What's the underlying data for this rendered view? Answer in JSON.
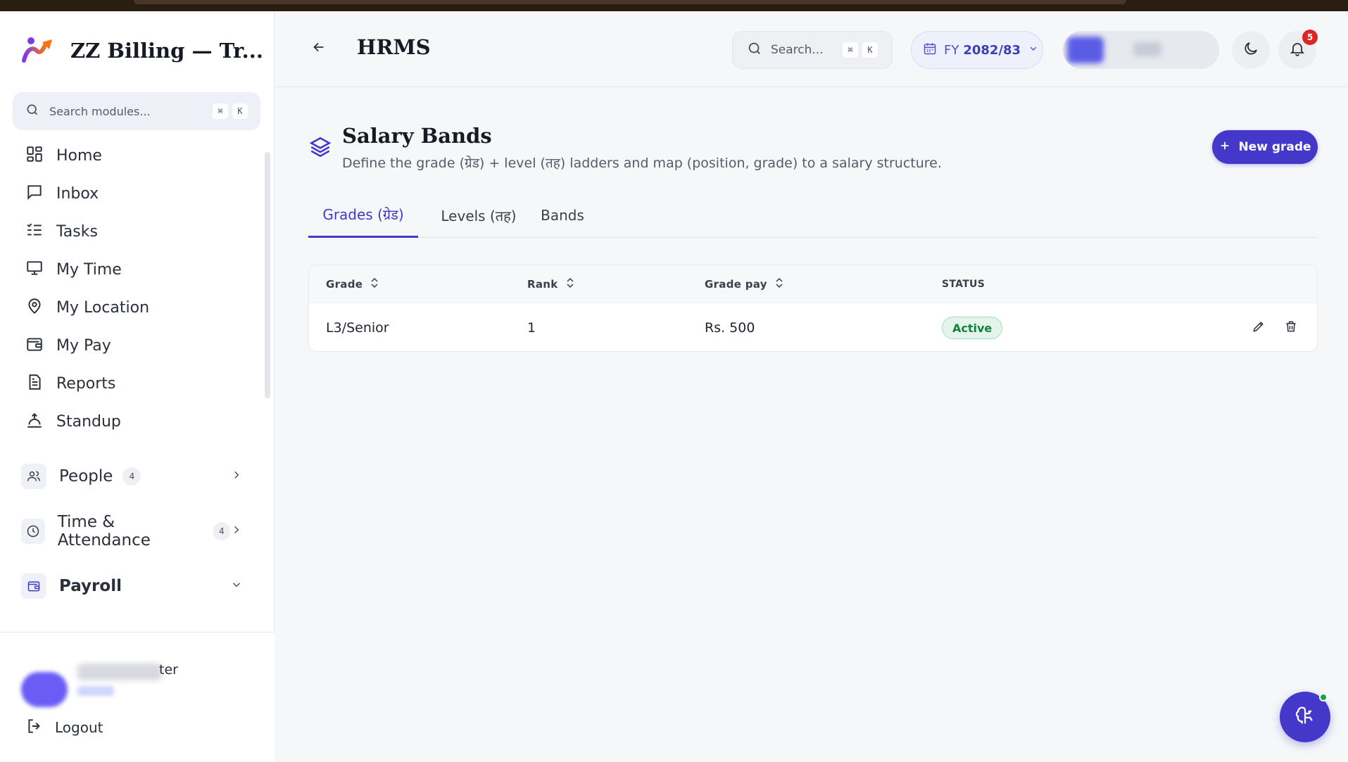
{
  "app": {
    "brand_title": "ZZ Billing — Tr...",
    "page_title": "HRMS"
  },
  "sidebar": {
    "search_placeholder": "Search modules...",
    "search_kbd": [
      "⌘",
      "K"
    ],
    "items": [
      {
        "label": "Home",
        "icon": "grid-icon"
      },
      {
        "label": "Inbox",
        "icon": "message-icon"
      },
      {
        "label": "Tasks",
        "icon": "checklist-icon"
      },
      {
        "label": "My Time",
        "icon": "monitor-icon"
      },
      {
        "label": "My Location",
        "icon": "location-pin-icon"
      },
      {
        "label": "My Pay",
        "icon": "wallet-icon"
      },
      {
        "label": "Reports",
        "icon": "document-icon"
      },
      {
        "label": "Standup",
        "icon": "sunrise-icon"
      }
    ],
    "groups": [
      {
        "label": "People",
        "count": "4",
        "icon": "users-icon"
      },
      {
        "label": "Time & Attendance",
        "count": "4",
        "icon": "clock-icon"
      },
      {
        "label": "Payroll",
        "icon": "wallet-icon"
      }
    ],
    "user": {
      "name_visible": "ter"
    },
    "logout_label": "Logout"
  },
  "header": {
    "search_placeholder": "Search...",
    "search_kbd": [
      "⌘",
      "K"
    ],
    "fy_prefix": "FY",
    "fy_value": "2082/83",
    "notification_count": "5"
  },
  "section": {
    "title": "Salary Bands",
    "description": "Define the grade (ग्रेड) + level (तह) ladders and map (position, grade) to a salary structure.",
    "new_button": "New grade"
  },
  "tabs": [
    {
      "label": "Grades (ग्रेड)",
      "active": true
    },
    {
      "label": "Levels (तह)",
      "active": false
    },
    {
      "label": "Bands",
      "active": false
    }
  ],
  "table": {
    "columns": [
      "Grade",
      "Rank",
      "Grade pay",
      "STATUS"
    ],
    "rows": [
      {
        "grade": "L3/Senior",
        "rank": "1",
        "grade_pay": "Rs. 500",
        "status": "Active"
      }
    ]
  },
  "colors": {
    "accent": "#4338ca",
    "status_active": "#15803d",
    "notification": "#dc2626"
  }
}
